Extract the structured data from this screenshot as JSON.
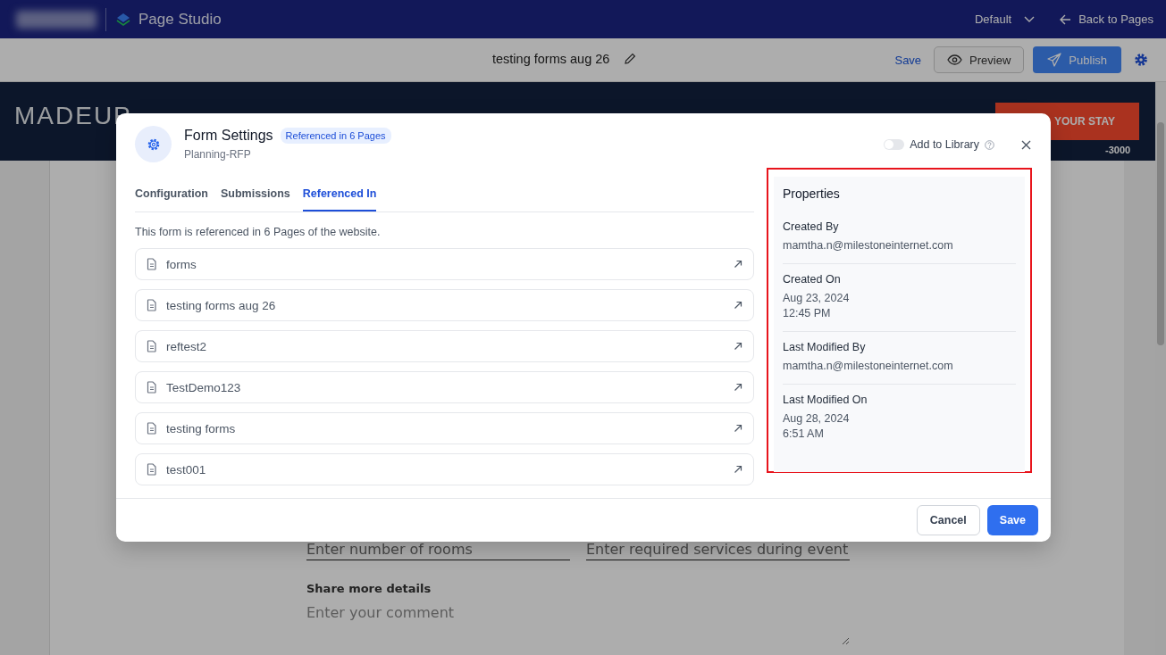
{
  "app_bar": {
    "product": "Page Studio",
    "theme": "Default",
    "back": "Back to Pages"
  },
  "toolbar": {
    "page_title": "testing forms aug 26",
    "save": "Save",
    "preview": "Preview",
    "publish": "Publish"
  },
  "site": {
    "logo": "MADEUP",
    "cta": "YOUR STAY",
    "phone": "-3000",
    "fields": [
      {
        "placeholder": "Enter number of rooms"
      },
      {
        "placeholder": "Enter required services during event"
      }
    ],
    "details_label": "Share more details",
    "comment_placeholder": "Enter your comment"
  },
  "dialog": {
    "title": "Form Settings",
    "badge": "Referenced in 6 Pages",
    "subtitle": "Planning-RFP",
    "library_toggle": {
      "label": "Add to Library",
      "on": false
    },
    "tabs": [
      {
        "label": "Configuration",
        "selected": false
      },
      {
        "label": "Submissions",
        "selected": false
      },
      {
        "label": "Referenced In",
        "selected": true
      }
    ],
    "note": "This form is referenced in 6 Pages of the website.",
    "pages": [
      "forms",
      "testing forms aug 26",
      "reftest2",
      "TestDemo123",
      "testing forms",
      "test001"
    ],
    "properties": {
      "title": "Properties",
      "items": [
        {
          "label": "Created By",
          "lines": [
            "mamtha.n@milestoneinternet.com"
          ]
        },
        {
          "label": "Created On",
          "lines": [
            "Aug 23, 2024",
            "12:45 PM"
          ]
        },
        {
          "label": "Last Modified By",
          "lines": [
            "mamtha.n@milestoneinternet.com"
          ]
        },
        {
          "label": "Last Modified On",
          "lines": [
            "Aug 28, 2024",
            "6:51 AM"
          ]
        }
      ]
    },
    "buttons": {
      "cancel": "Cancel",
      "save": "Save"
    }
  }
}
